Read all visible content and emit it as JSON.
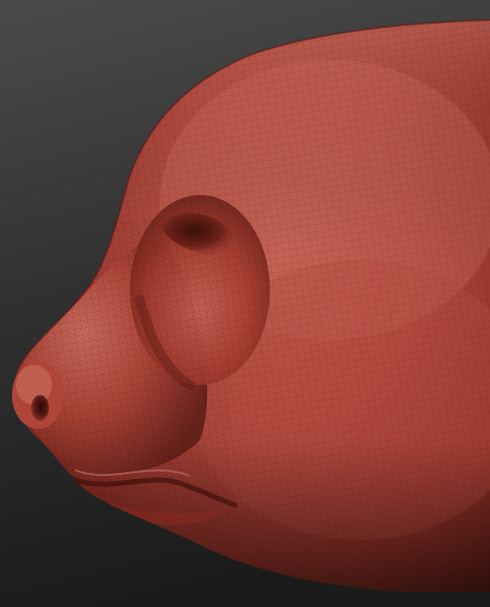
{
  "scene": {
    "subject": "",
    "background_color_top": "#4a4a4a",
    "background_color_bottom": "#1e1e1e",
    "material_base": "#a63a30",
    "material_highlight": "#d27a6c",
    "material_shadow": "#4a1612",
    "wire_color": "#3b0f0c"
  }
}
